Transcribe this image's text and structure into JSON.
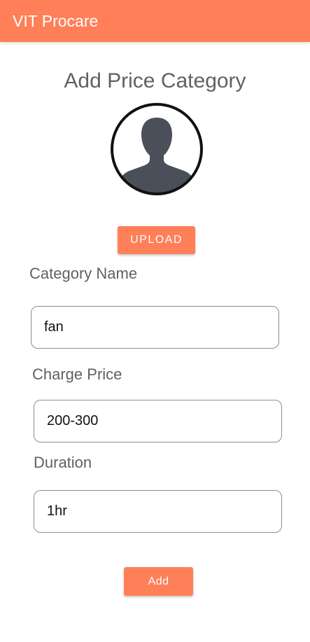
{
  "theme": {
    "accent": "#ff7f58",
    "avatar_fill": "#4a4f5a"
  },
  "app_bar": {
    "title": "VIT Procare"
  },
  "page": {
    "title": "Add Price Category"
  },
  "avatar": {
    "icon": "person-silhouette-icon"
  },
  "upload_button": {
    "label": "UPLOAD"
  },
  "fields": {
    "category_name": {
      "label": "Category Name",
      "value": "fan"
    },
    "charge_price": {
      "label": "Charge Price",
      "value": "200-300"
    },
    "duration": {
      "label": "Duration",
      "value": "1hr"
    }
  },
  "add_button": {
    "label": "Add"
  }
}
